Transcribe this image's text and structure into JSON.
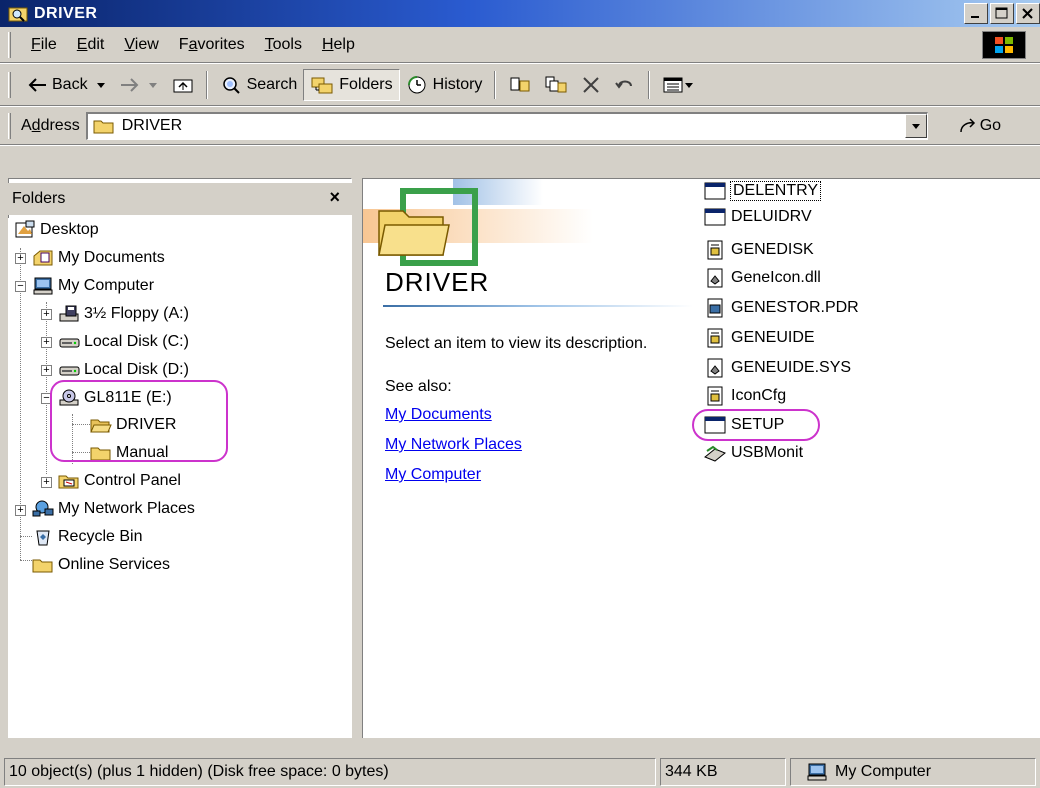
{
  "window": {
    "title": "DRIVER",
    "caption": {
      "minimize": "_",
      "maximize": "□",
      "close": "×"
    }
  },
  "menubar": {
    "items": [
      {
        "label": "File",
        "u": "F",
        "rest": "ile"
      },
      {
        "label": "Edit",
        "u": "E",
        "rest": "dit"
      },
      {
        "label": "View",
        "u": "V",
        "rest": "iew"
      },
      {
        "label": "Favorites",
        "pre": "F",
        "u": "a",
        "rest": "vorites"
      },
      {
        "label": "Tools",
        "u": "T",
        "rest": "ools"
      },
      {
        "label": "Help",
        "u": "H",
        "rest": "elp"
      }
    ]
  },
  "toolbar": {
    "back_label": "Back",
    "search_label": "Search",
    "folders_label": "Folders",
    "history_label": "History"
  },
  "address": {
    "label_pre": "A",
    "label_u": "d",
    "label_rest": "dress",
    "value": "DRIVER",
    "go_label": "Go"
  },
  "folders": {
    "header": "Folders",
    "close": "×",
    "tree": [
      {
        "label": "Desktop"
      },
      {
        "label": "My Documents"
      },
      {
        "label": "My Computer"
      },
      {
        "label": "3½ Floppy (A:)"
      },
      {
        "label": "Local Disk (C:)"
      },
      {
        "label": "Local Disk (D:)"
      },
      {
        "label": "GL811E (E:)"
      },
      {
        "label": "DRIVER"
      },
      {
        "label": "Manual"
      },
      {
        "label": "Control Panel"
      },
      {
        "label": "My Network Places"
      },
      {
        "label": "Recycle Bin"
      },
      {
        "label": "Online Services"
      }
    ]
  },
  "webview": {
    "title": "DRIVER",
    "description": "Select an item to view its description.",
    "see_also": "See also:",
    "links": [
      "My Documents",
      "My Network Places",
      "My Computer"
    ]
  },
  "files": [
    {
      "name": "DELENTRY",
      "icon": "app-window-icon"
    },
    {
      "name": "DELUIDRV",
      "icon": "app-window-icon"
    },
    {
      "name": "GENEDISK",
      "icon": "config-file-icon"
    },
    {
      "name": "GeneIcon.dll",
      "icon": "dll-file-icon"
    },
    {
      "name": "GENESTOR.PDR",
      "icon": "system-file-icon"
    },
    {
      "name": "GENEUIDE",
      "icon": "config-file-icon"
    },
    {
      "name": "GENEUIDE.SYS",
      "icon": "dll-file-icon"
    },
    {
      "name": "IconCfg",
      "icon": "config-file-icon"
    },
    {
      "name": "SETUP",
      "icon": "app-window-icon"
    },
    {
      "name": "USBMonit",
      "icon": "usb-monitor-icon"
    }
  ],
  "status": {
    "objects": "10 object(s) (plus 1 hidden) (Disk free space: 0 bytes)",
    "size": "344 KB",
    "zone": "My Computer"
  },
  "colors": {
    "title_start": "#0a246a",
    "title_end": "#a6caf0",
    "annotation": "#cc33cc",
    "link": "#0000ee"
  }
}
